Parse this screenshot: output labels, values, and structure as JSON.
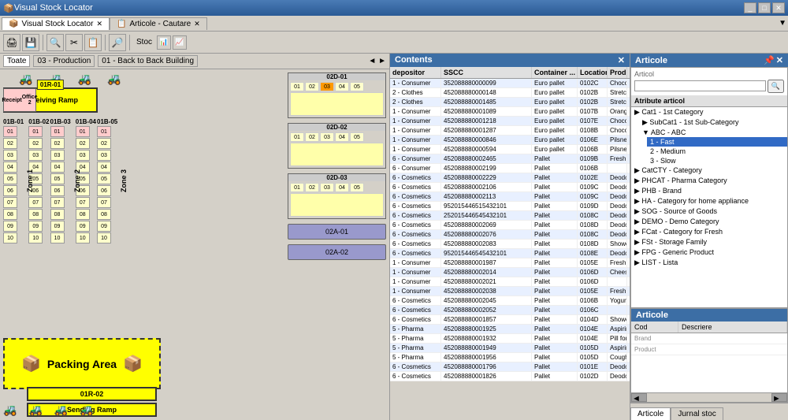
{
  "app": {
    "title": "Visual Stock Locator",
    "tabs": [
      {
        "label": "Visual Stock Locator",
        "active": true
      },
      {
        "label": "Articole - Cautare",
        "active": false
      }
    ]
  },
  "toolbar": {
    "buttons": [
      "🖨",
      "💾",
      "🔍",
      "✂",
      "📋",
      "🔎"
    ]
  },
  "nav": {
    "all_label": "Toate",
    "production_label": "03 - Production",
    "building_label": "01 - Back to Back Building",
    "nav_arrows": "◄ ►"
  },
  "warehouse": {
    "racks": {
      "B01": {
        "label": "01B-01",
        "cells": [
          "01",
          "02",
          "03",
          "04",
          "05",
          "06",
          "07",
          "08",
          "09",
          "10"
        ]
      },
      "B02": {
        "label": "01B-02",
        "cells": [
          "01",
          "02",
          "03",
          "04",
          "05",
          "06",
          "07",
          "08",
          "09",
          "10"
        ]
      },
      "B03": {
        "label": "01B-03",
        "cells": [
          "01",
          "02",
          "03",
          "04",
          "05",
          "06",
          "07",
          "08",
          "09",
          "10"
        ]
      },
      "B04": {
        "label": "01B-04",
        "cells": [
          "01",
          "02",
          "03",
          "04",
          "05",
          "06",
          "07",
          "08",
          "09",
          "10"
        ]
      },
      "B05": {
        "label": "01B-05",
        "cells": [
          "01",
          "02",
          "03",
          "04",
          "05",
          "06",
          "07",
          "08",
          "09",
          "10"
        ]
      }
    },
    "zones": [
      "Zone 1",
      "Zone 2",
      "Zone 3"
    ],
    "special": {
      "receiving_ramp": "Receiving Ramp",
      "receipt_office1": "Receipt Office 1",
      "receipt_office2": "Receipt Office 2",
      "packing_area": "Packing Area",
      "sending_ramp": "Sending Ramp",
      "rack_01R01": "01R-01",
      "rack_01R02": "01R-02"
    },
    "bays": {
      "bay1": {
        "label": "02D-01",
        "rows": [
          [
            "01",
            "02",
            "03",
            "04",
            "05"
          ]
        ]
      },
      "bay2": {
        "label": "02D-02",
        "rows": [
          [
            "01",
            "02",
            "03",
            "04",
            "05"
          ]
        ]
      },
      "bay3": {
        "label": "02D-03",
        "rows": [
          [
            "01",
            "02",
            "03",
            "04",
            "05"
          ]
        ]
      },
      "area1": "02A-01",
      "area2": "02A-02"
    }
  },
  "contents": {
    "panel_title": "Contents",
    "columns": [
      {
        "key": "depositor",
        "label": "depositor",
        "width": 65
      },
      {
        "key": "sscc",
        "label": "SSCC",
        "width": 115
      },
      {
        "key": "container",
        "label": "Container ...",
        "width": 58
      },
      {
        "key": "location",
        "label": "Location",
        "width": 38
      },
      {
        "key": "product",
        "label": "Produ...",
        "width": 30
      }
    ],
    "rows": [
      {
        "depositor": "1 - Consumer",
        "sscc": "352088880000099",
        "container": "Euro pallet",
        "location": "0102C",
        "product": "Choco"
      },
      {
        "depositor": "2 - Clothes",
        "sscc": "452088880000148",
        "container": "Euro pallet",
        "location": "0102B",
        "product": "Stretch"
      },
      {
        "depositor": "2 - Clothes",
        "sscc": "452088880001485",
        "container": "Euro pallet",
        "location": "0102B",
        "product": "Stretch"
      },
      {
        "depositor": "1 - Consumer",
        "sscc": "452088880001089",
        "container": "Euro pallet",
        "location": "0107B",
        "product": "Orang"
      },
      {
        "depositor": "1 - Consumer",
        "sscc": "452088880001218",
        "container": "Euro pallet",
        "location": "0107E",
        "product": "Choco"
      },
      {
        "depositor": "1 - Consumer",
        "sscc": "452088880001287",
        "container": "Euro pallet",
        "location": "0108B",
        "product": "Choco"
      },
      {
        "depositor": "1 - Consumer",
        "sscc": "452088880000846",
        "container": "Euro pallet",
        "location": "0106E",
        "product": "Pilsner"
      },
      {
        "depositor": "1 - Consumer",
        "sscc": "452088880000594",
        "container": "Euro pallet",
        "location": "0106B",
        "product": "Pilsner"
      },
      {
        "depositor": "6 - Consumer",
        "sscc": "452088880002465",
        "container": "Pallet",
        "location": "0109B",
        "product": "Fresh f"
      },
      {
        "depositor": "6 - Consumer",
        "sscc": "452088880002199",
        "container": "Pallet",
        "location": "0106B",
        "product": ""
      },
      {
        "depositor": "6 - Cosmetics",
        "sscc": "452088880002229",
        "container": "Pallet",
        "location": "0102E",
        "product": "Deodo"
      },
      {
        "depositor": "6 - Cosmetics",
        "sscc": "452088880002106",
        "container": "Pallet",
        "location": "0109C",
        "product": "Deodo"
      },
      {
        "depositor": "6 - Cosmetics",
        "sscc": "452088880002113",
        "container": "Pallet",
        "location": "0109C",
        "product": "Deodo"
      },
      {
        "depositor": "6 - Cosmetics",
        "sscc": "952015446515432101",
        "container": "Pallet",
        "location": "0109D",
        "product": "Deodo"
      },
      {
        "depositor": "6 - Cosmetics",
        "sscc": "252015446545432101",
        "container": "Pallet",
        "location": "0108C",
        "product": "Deodo"
      },
      {
        "depositor": "6 - Cosmetics",
        "sscc": "452088880002069",
        "container": "Pallet",
        "location": "0108D",
        "product": "Deodo"
      },
      {
        "depositor": "6 - Cosmetics",
        "sscc": "452088880002076",
        "container": "Pallet",
        "location": "0108C",
        "product": "Deodo"
      },
      {
        "depositor": "6 - Cosmetics",
        "sscc": "452088880002083",
        "container": "Pallet",
        "location": "0108D",
        "product": "Showe"
      },
      {
        "depositor": "6 - Cosmetics",
        "sscc": "952015446545432101",
        "container": "Pallet",
        "location": "0108E",
        "product": "Deodo"
      },
      {
        "depositor": "1 - Consumer",
        "sscc": "452088880001987",
        "container": "Pallet",
        "location": "0105E",
        "product": "Fresh f"
      },
      {
        "depositor": "1 - Consumer",
        "sscc": "452088880002014",
        "container": "Pallet",
        "location": "0106D",
        "product": "Chees"
      },
      {
        "depositor": "1 - Consumer",
        "sscc": "452088880002021",
        "container": "Pallet",
        "location": "0106D",
        "product": ""
      },
      {
        "depositor": "1 - Consumer",
        "sscc": "452088880002038",
        "container": "Pallet",
        "location": "0105E",
        "product": "Fresh f"
      },
      {
        "depositor": "6 - Cosmetics",
        "sscc": "452088880002045",
        "container": "Pallet",
        "location": "0106B",
        "product": "Yogurt"
      },
      {
        "depositor": "6 - Cosmetics",
        "sscc": "452088880002052",
        "container": "Pallet",
        "location": "0106C",
        "product": ""
      },
      {
        "depositor": "6 - Cosmetics",
        "sscc": "452088880001857",
        "container": "Pallet",
        "location": "0104D",
        "product": "Showe"
      },
      {
        "depositor": "5 - Pharma",
        "sscc": "452088880001925",
        "container": "Pallet",
        "location": "0104E",
        "product": "Aspirin"
      },
      {
        "depositor": "5 - Pharma",
        "sscc": "452088880001932",
        "container": "Pallet",
        "location": "0104E",
        "product": "Pill for"
      },
      {
        "depositor": "5 - Pharma",
        "sscc": "452088880001949",
        "container": "Pallet",
        "location": "0105D",
        "product": "Aspirin"
      },
      {
        "depositor": "5 - Pharma",
        "sscc": "452088880001956",
        "container": "Pallet",
        "location": "0105D",
        "product": "Cough"
      },
      {
        "depositor": "6 - Cosmetics",
        "sscc": "452088880001796",
        "container": "Pallet",
        "location": "0101E",
        "product": "Deodo"
      },
      {
        "depositor": "6 - Cosmetics",
        "sscc": "452088880001826",
        "container": "Pallet",
        "location": "0102D",
        "product": "Deodo"
      }
    ]
  },
  "articole": {
    "panel_title": "Articole",
    "search_placeholder": "",
    "articol_label": "Articol",
    "attribute_label": "Atribute articol",
    "tree": [
      {
        "level": 0,
        "label": "Cat1 - 1st Category"
      },
      {
        "level": 1,
        "label": "SubCat1 - 1st Sub-Category"
      },
      {
        "level": 1,
        "label": "ABC - ABC",
        "expanded": true
      },
      {
        "level": 2,
        "label": "1 - Fast",
        "selected": true
      },
      {
        "level": 2,
        "label": "2 - Medium"
      },
      {
        "level": 2,
        "label": "3 - Slow"
      },
      {
        "level": 0,
        "label": "CatCTY - Category"
      },
      {
        "level": 0,
        "label": "PHCAT - Pharma Category"
      },
      {
        "level": 0,
        "label": "PHB - Brand"
      },
      {
        "level": 0,
        "label": "HA - Category for home appliance"
      },
      {
        "level": 0,
        "label": "SOG - Source of Goods"
      },
      {
        "level": 0,
        "label": "DEMO - Demo Category"
      },
      {
        "level": 0,
        "label": "FCat - Category for Fresh"
      },
      {
        "level": 0,
        "label": "FSt - Storage Family"
      },
      {
        "level": 0,
        "label": "FPG - Generic Product"
      },
      {
        "level": 0,
        "label": "LIST - Lista"
      }
    ],
    "bottom_title": "Articole",
    "bottom_columns": [
      {
        "key": "cod",
        "label": "Cod"
      },
      {
        "key": "descriere",
        "label": "Descriere"
      }
    ],
    "bottom_col_headers": {
      "brand_label": "Brand",
      "product_label": "Product"
    },
    "bottom_tabs": [
      {
        "label": "Articole",
        "active": true
      },
      {
        "label": "Jurnal stoc",
        "active": false
      }
    ]
  }
}
